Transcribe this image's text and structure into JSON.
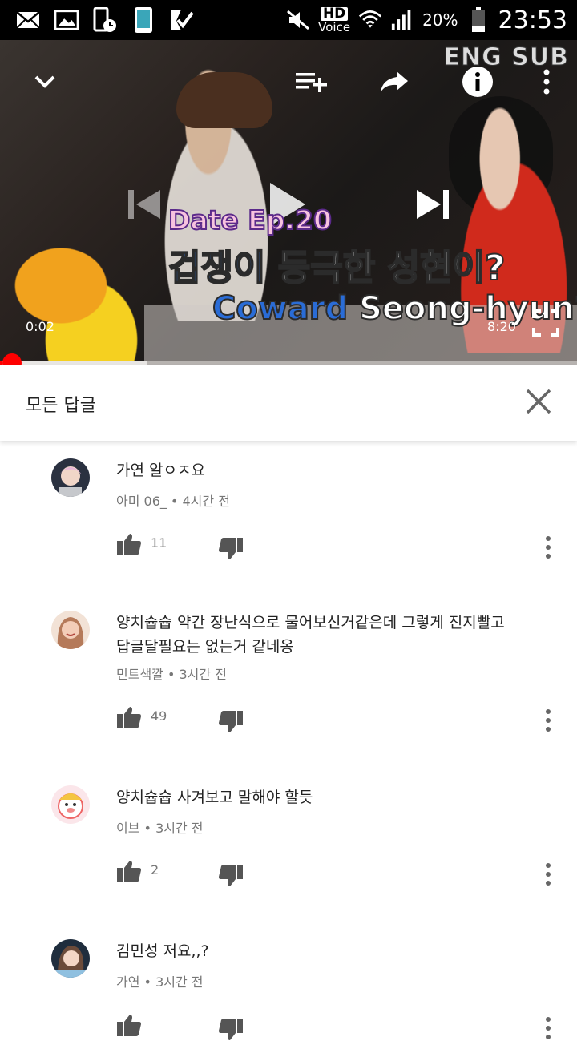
{
  "status_bar": {
    "hd_label": "HD",
    "voice_label": "Voice",
    "battery_percent": "20%",
    "time": "23:53",
    "icons": [
      "mail-icon",
      "image-icon",
      "phone-schedule-icon",
      "phone-icon",
      "checkbox-icon",
      "mute-icon",
      "wifi-icon",
      "signal-icon",
      "battery-icon"
    ]
  },
  "video": {
    "eng_sub": "ENG SUB",
    "title_line1": "Date Ep.20",
    "title_line2_hl": "겁쟁이",
    "title_line2_rest": " 등극한 성현이?",
    "title_line3_hl": "Coward",
    "title_line3_rest": " Seong-hyun?",
    "current_time": "0:02",
    "total_time": "8:20",
    "progress_fraction": 0.004,
    "buffer_fraction": 0.255
  },
  "replies": {
    "title": "모든 답글",
    "comments": [
      {
        "text": "가연 알ㅇㅈ요",
        "author": "아미 06_",
        "time": "4시간 전",
        "likes": "11"
      },
      {
        "text": "양치슙슙 약간 장난식으로 물어보신거같은데 그렇게 진지빨고 답글달필요는 없는거 같네옹",
        "author": "민트색깔",
        "time": "3시간 전",
        "likes": "49"
      },
      {
        "text": "양치슙슙 사겨보고 말해야 할듯",
        "author": "이브",
        "time": "3시간 전",
        "likes": "2"
      },
      {
        "text": "김민성 저요,,?",
        "author": "가연",
        "time": "3시간 전",
        "likes": ""
      }
    ]
  },
  "colors": {
    "accent": "#ff0000",
    "text": "#222222",
    "meta": "#777777"
  }
}
